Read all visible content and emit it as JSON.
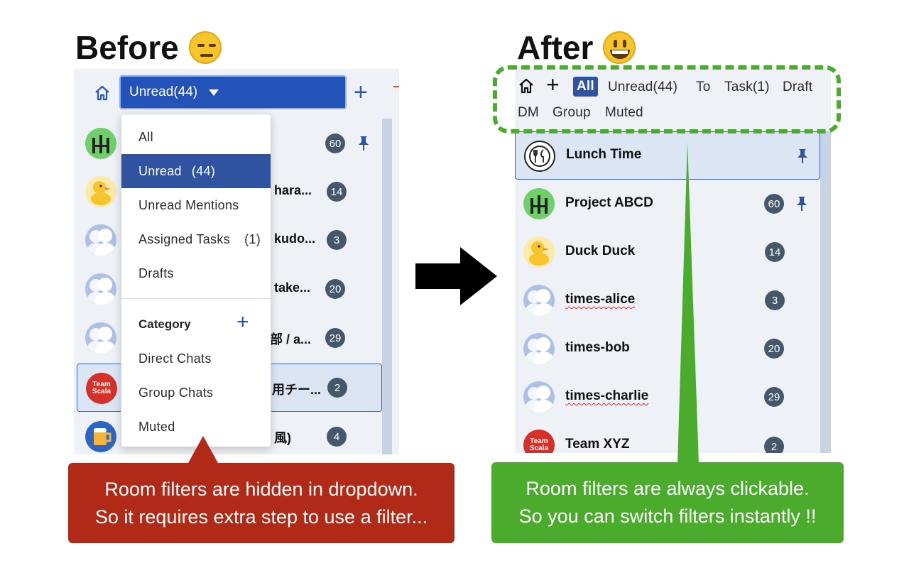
{
  "before": {
    "title": "Before",
    "emoji": "expressionless-face-emoji",
    "select_label": "Unread(44)",
    "dropdown": {
      "items": [
        {
          "label": "All",
          "count": ""
        },
        {
          "label": "Unread",
          "count": "(44)"
        },
        {
          "label": "Unread Mentions",
          "count": ""
        },
        {
          "label": "Assigned Tasks",
          "count": "(1)"
        },
        {
          "label": "Drafts",
          "count": ""
        }
      ],
      "category_label": "Category",
      "categories": [
        "Direct Chats",
        "Group Chats",
        "Muted"
      ]
    },
    "rooms": [
      {
        "name": "",
        "badge": "60",
        "pinned": true
      },
      {
        "name": "hara...",
        "badge": "14",
        "pinned": false
      },
      {
        "name": "kudo...",
        "badge": "3",
        "pinned": false
      },
      {
        "name": "take...",
        "badge": "20",
        "pinned": false
      },
      {
        "name": "部 / a...",
        "badge": "29",
        "pinned": false
      },
      {
        "name": "用チー...",
        "badge": "2",
        "pinned": false
      },
      {
        "name": "風)",
        "badge": "4",
        "pinned": false
      }
    ],
    "callout_line1": "Room filters are hidden in dropdown.",
    "callout_line2": "So it requires extra step to use a filter..."
  },
  "after": {
    "title": "After",
    "emoji": "grinning-face-emoji",
    "filters_row1": [
      "All",
      "Unread(44)",
      "To",
      "Task(1)",
      "Draft"
    ],
    "filters_row2": [
      "DM",
      "Group",
      "Muted"
    ],
    "rooms": [
      {
        "name": "Lunch Time",
        "badge": "",
        "pinned": true
      },
      {
        "name": "Project ABCD",
        "badge": "60",
        "pinned": true
      },
      {
        "name": "Duck Duck",
        "badge": "14",
        "pinned": false
      },
      {
        "name": "times-alice",
        "badge": "3",
        "pinned": false
      },
      {
        "name": "times-bob",
        "badge": "20",
        "pinned": false
      },
      {
        "name": "times-charlie",
        "badge": "29",
        "pinned": false
      },
      {
        "name": "Team XYZ",
        "badge": "2",
        "pinned": false
      }
    ],
    "callout_line1": "Room filters are always clickable.",
    "callout_line2": "So you can switch filters instantly !!"
  },
  "avatars": {
    "team_line1": "Team",
    "team_line2": "Scala"
  },
  "colors": {
    "accent_blue": "#2353b8",
    "active_filter": "#2f53a0",
    "badge": "#45586b",
    "callout_red": "#b02a17",
    "callout_green": "#4aab2c"
  }
}
